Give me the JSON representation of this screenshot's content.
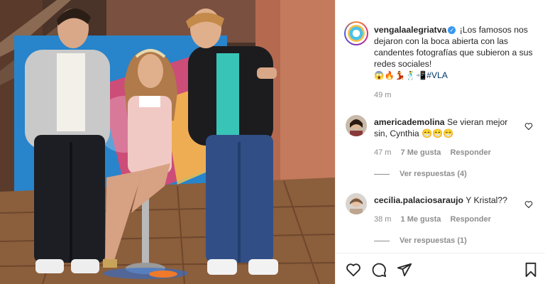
{
  "post": {
    "username": "vengalaalegriatva",
    "caption": "¡Los famosos nos dejaron con la boca abierta con las candentes fotografías que subieron a sus redes sociales!",
    "emojis": "😱🔥💃🕺📲",
    "hashtag": "#VLA",
    "time": "49 m",
    "verified_symbol": "✓"
  },
  "comments": [
    {
      "username": "americademolina",
      "text": "Se vieran mejor sin, Cynthia 😁😁😁",
      "time": "47 m",
      "likes": "7 Me gusta",
      "reply_label": "Responder",
      "replies_label": "Ver respuestas (4)"
    },
    {
      "username": "cecilia.palaciosaraujo",
      "text": "Y Kristal??",
      "time": "38 m",
      "likes": "1 Me gusta",
      "reply_label": "Responder",
      "replies_label": "Ver respuestas (1)"
    }
  ],
  "icons": [
    "heart-icon",
    "comment-icon",
    "share-icon",
    "bookmark-icon"
  ],
  "colors": {
    "verified": "#3897f0",
    "hashtag": "#00376b",
    "muted": "#8e8e8e"
  }
}
